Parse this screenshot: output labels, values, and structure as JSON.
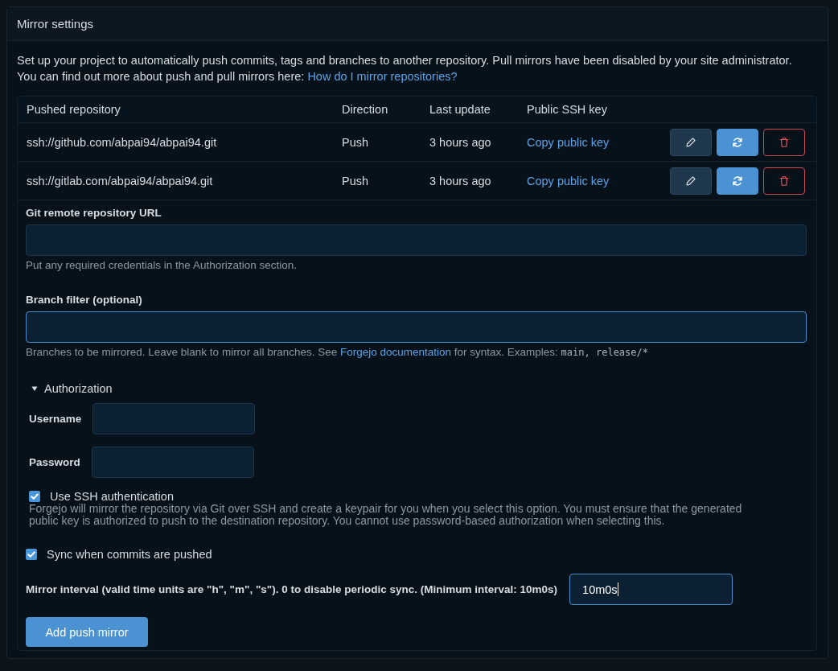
{
  "panel": {
    "title": "Mirror settings"
  },
  "description": {
    "text": "Set up your project to automatically push commits, tags and branches to another repository. Pull mirrors have been disabled by your site administrator.\nYou can find out more about push and pull mirrors here: ",
    "link": "How do I mirror repositories?"
  },
  "mirrors_table": {
    "columns": [
      "Pushed repository",
      "Direction",
      "Last update",
      "Public SSH key"
    ],
    "rows": [
      {
        "repository": "ssh://github.com/abpai94/abpai94.git",
        "direction": "Push",
        "last_update": "3 hours ago",
        "key_link": "Copy public key"
      },
      {
        "repository": "ssh://gitlab.com/abpai94/abpai94.git",
        "direction": "Push",
        "last_update": "3 hours ago",
        "key_link": "Copy public key"
      }
    ]
  },
  "remote_url": {
    "label": "Git remote repository URL",
    "hint": "Put any required credentials in the Authorization section.",
    "focused": false
  },
  "branch_filter": {
    "label": "Branch filter (optional)",
    "hint_before": "Branches to be mirrored. Leave blank to mirror all branches. See ",
    "hint_link": "Forgejo documentation",
    "hint_after": " for syntax. Examples: ",
    "hint_code": "main, release/*",
    "focused": true
  },
  "authorization": {
    "label": "Authorization",
    "expanded": true,
    "fields": [
      {
        "label": "Username"
      },
      {
        "label": "Password"
      }
    ],
    "ssh_option": {
      "label": "Use SSH authentication",
      "checked": true,
      "help": "Forgejo will mirror the repository via Git over SSH and create a keypair for you when you select this option. You must ensure that the generated public key is authorized to push to the destination repository. You cannot use password-based authorization when selecting this."
    }
  },
  "sync_on_push": {
    "label": "Sync when commits are pushed",
    "checked": true
  },
  "interval": {
    "label": "Mirror interval (valid time units are \"h\", \"m\", \"s\"). 0 to disable periodic sync. (Minimum interval: 10m0s)",
    "value": "10m0s",
    "focused": true
  },
  "submit_button": "Add push mirror"
}
